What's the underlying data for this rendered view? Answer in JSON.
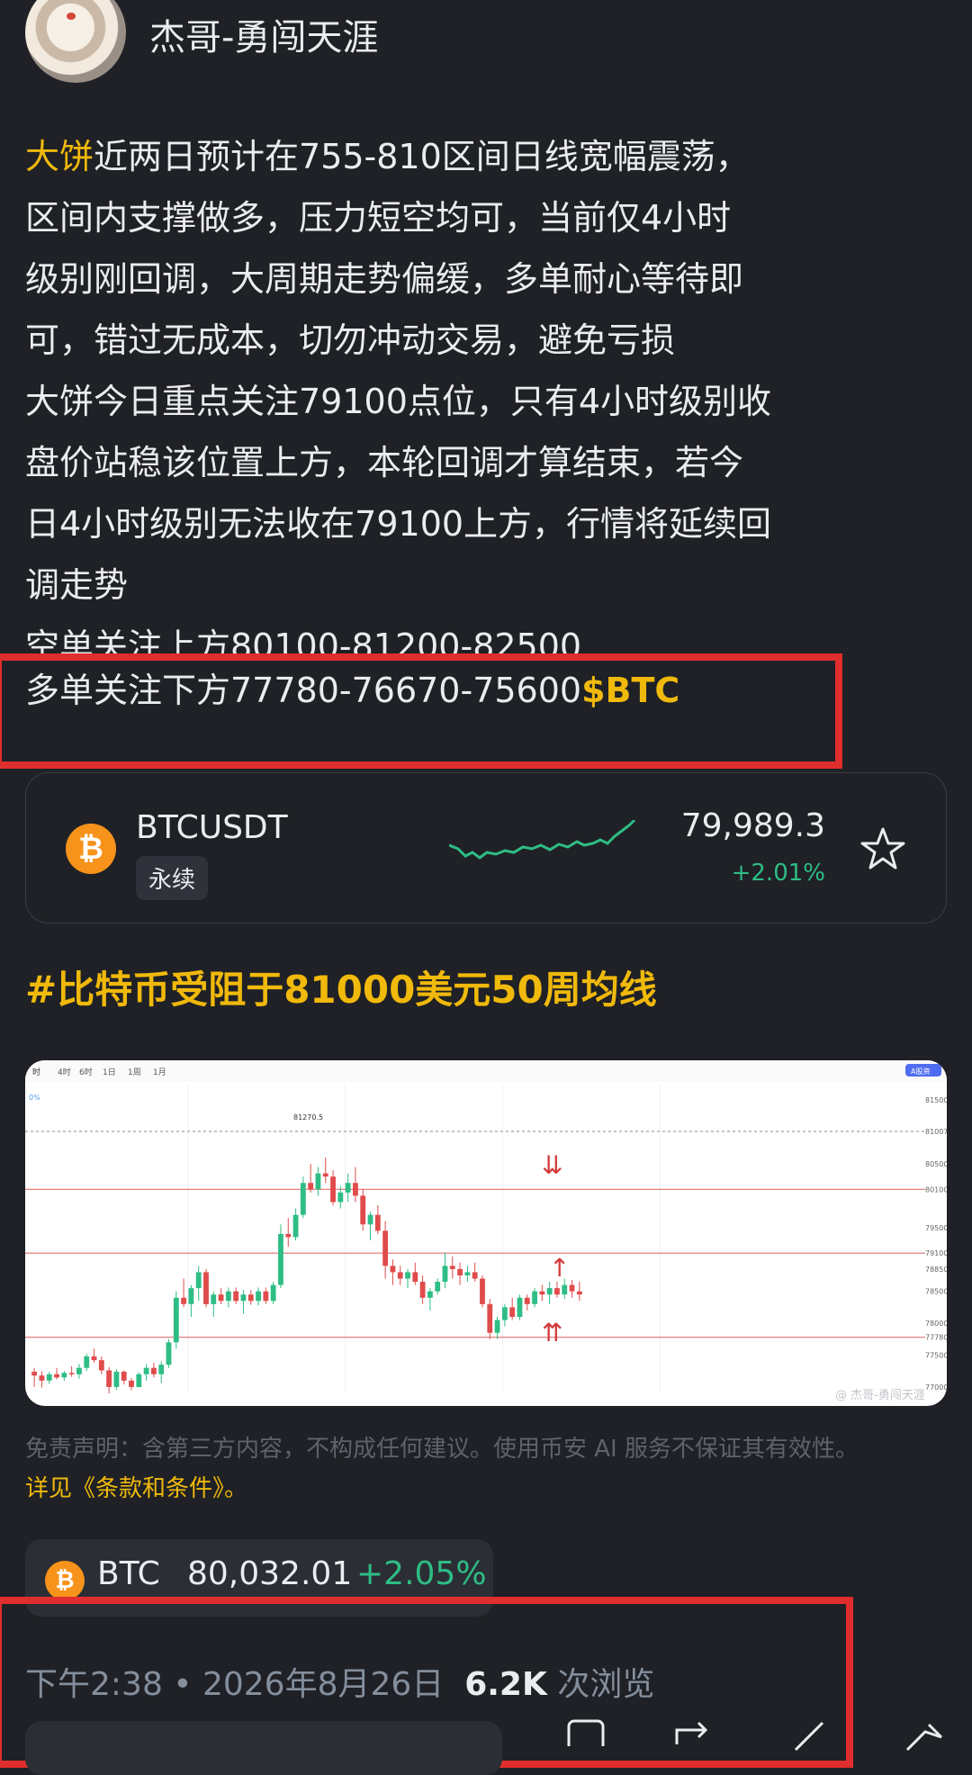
{
  "author": {
    "name": "杰哥-勇闯天涯"
  },
  "post": {
    "p1_highlight": "大饼",
    "p1_lines": [
      "近两日预计在755-810区间日线宽幅震荡，",
      "区间内支撑做多，压力短空均可，当前仅4小时",
      "级别刚回调，大周期走势偏缓，多单耐心等待即",
      "可，错过无成本，切勿冲动交易，避免亏损"
    ],
    "p2_lines": [
      "大饼今日重点关注79100点位，只有4小时级别收",
      "盘价站稳该位置上方，本轮回调才算结束，若今",
      "日4小时级别无法收在79100上方，行情将延续回",
      "调走势"
    ],
    "short_line": "空单关注上方80100-81200-82500",
    "long_line": "多单关注下方77780-76670-75600",
    "long_tag": "$BTC"
  },
  "ticker": {
    "symbol": "BTCUSDT",
    "badge": "永续",
    "price": "79,989.3",
    "change": "+2.01%",
    "coin_glyph": "₿",
    "star_icon": "star-outline",
    "colors": {
      "up": "#2ebd85",
      "coin": "#f7931a"
    }
  },
  "heading": "#比特币受阻于81000美元50周均线",
  "chart": {
    "tabs": [
      "时",
      "4时",
      "6时",
      "1日",
      "1周",
      "1月"
    ],
    "top_right": "A股资",
    "pct_label": "0%",
    "high_label": "81270.5",
    "price_axis": [
      "81500.0",
      "81007.7",
      "80500.0",
      "80100.0",
      "79500.0",
      "79100.0",
      "78850.3",
      "78500.0",
      "78000.0",
      "77780.0",
      "77500.0",
      "77000.0"
    ],
    "watermark": "@ 杰哥-勇闯天涯",
    "levels": [
      80100,
      79100,
      77780
    ],
    "arrows": [
      "⇊",
      "↑",
      "⇈"
    ],
    "chart_data": {
      "type": "candlestick",
      "ylim": [
        76900,
        81700
      ],
      "candles": [
        [
          77240,
          77300,
          77000,
          77180
        ],
        [
          77180,
          77250,
          76990,
          77100
        ],
        [
          77100,
          77240,
          77050,
          77200
        ],
        [
          77200,
          77300,
          77120,
          77150
        ],
        [
          77150,
          77250,
          77100,
          77220
        ],
        [
          77220,
          77330,
          77160,
          77200
        ],
        [
          77200,
          77360,
          77130,
          77300
        ],
        [
          77300,
          77520,
          77250,
          77480
        ],
        [
          77480,
          77600,
          77380,
          77420
        ],
        [
          77420,
          77480,
          77200,
          77260
        ],
        [
          77260,
          77310,
          76900,
          77000
        ],
        [
          77000,
          77280,
          76950,
          77240
        ],
        [
          77240,
          77260,
          77040,
          77100
        ],
        [
          77100,
          77140,
          76950,
          77000
        ],
        [
          77000,
          77230,
          76990,
          77200
        ],
        [
          77200,
          77360,
          77100,
          77300
        ],
        [
          77300,
          77380,
          77150,
          77200
        ],
        [
          77200,
          77400,
          77060,
          77350
        ],
        [
          77350,
          77750,
          77300,
          77700
        ],
        [
          77700,
          78500,
          77600,
          78400
        ],
        [
          78400,
          78700,
          78250,
          78300
        ],
        [
          78300,
          78600,
          78100,
          78550
        ],
        [
          78550,
          78900,
          78350,
          78800
        ],
        [
          78800,
          78850,
          78250,
          78300
        ],
        [
          78300,
          78500,
          78100,
          78450
        ],
        [
          78450,
          78550,
          78300,
          78350
        ],
        [
          78350,
          78560,
          78250,
          78500
        ],
        [
          78500,
          78560,
          78300,
          78350
        ],
        [
          78350,
          78520,
          78150,
          78450
        ],
        [
          78450,
          78520,
          78290,
          78350
        ],
        [
          78350,
          78560,
          78280,
          78500
        ],
        [
          78500,
          78560,
          78300,
          78350
        ],
        [
          78350,
          78650,
          78300,
          78600
        ],
        [
          78600,
          79550,
          78550,
          79400
        ],
        [
          79400,
          79650,
          79200,
          79350
        ],
        [
          79350,
          79800,
          79300,
          79700
        ],
        [
          79700,
          80300,
          79650,
          80200
        ],
        [
          80200,
          80500,
          80050,
          80100
        ],
        [
          80100,
          80450,
          80000,
          80350
        ],
        [
          80350,
          80600,
          80200,
          80300
        ],
        [
          80300,
          80400,
          79850,
          79900
        ],
        [
          79900,
          80150,
          79800,
          80050
        ],
        [
          80050,
          80350,
          79900,
          80200
        ],
        [
          80200,
          80450,
          79900,
          80000
        ],
        [
          80000,
          80100,
          79450,
          79550
        ],
        [
          79550,
          79750,
          79300,
          79700
        ],
        [
          79700,
          79850,
          79400,
          79450
        ],
        [
          79450,
          79600,
          78700,
          78900
        ],
        [
          78900,
          79000,
          78600,
          78800
        ],
        [
          78800,
          78900,
          78600,
          78700
        ],
        [
          78700,
          78850,
          78550,
          78800
        ],
        [
          78800,
          78950,
          78600,
          78650
        ],
        [
          78650,
          78750,
          78300,
          78400
        ],
        [
          78400,
          78550,
          78200,
          78500
        ],
        [
          78500,
          78700,
          78450,
          78650
        ],
        [
          78650,
          79100,
          78550,
          78900
        ],
        [
          78900,
          79050,
          78700,
          78850
        ],
        [
          78850,
          78950,
          78600,
          78750
        ],
        [
          78750,
          78900,
          78650,
          78800
        ],
        [
          78800,
          78950,
          78650,
          78700
        ],
        [
          78700,
          78750,
          78250,
          78300
        ],
        [
          78300,
          78380,
          77750,
          77850
        ],
        [
          77850,
          78100,
          77750,
          78050
        ],
        [
          78050,
          78300,
          77950,
          78250
        ],
        [
          78250,
          78400,
          78050,
          78100
        ],
        [
          78100,
          78450,
          78050,
          78400
        ],
        [
          78400,
          78450,
          78200,
          78300
        ],
        [
          78300,
          78550,
          78250,
          78500
        ],
        [
          78500,
          78600,
          78350,
          78450
        ],
        [
          78450,
          78650,
          78300,
          78550
        ],
        [
          78550,
          78650,
          78400,
          78450
        ],
        [
          78450,
          78700,
          78380,
          78600
        ],
        [
          78600,
          78680,
          78400,
          78500
        ],
        [
          78500,
          78650,
          78350,
          78450
        ]
      ]
    }
  },
  "disclaimer": {
    "text": "免责声明：含第三方内容，不构成任何建议。使用币安 AI 服务不保证其有效性。",
    "link": "详见《条款和条件》。"
  },
  "chip": {
    "symbol": "BTC",
    "price": "80,032.01",
    "change": "+2.05%",
    "coin_glyph": "₿"
  },
  "meta": {
    "time": "下午2:38 • 2026年8月26日",
    "views": "6.2K",
    "views_suffix": "次浏览"
  },
  "bottom_icons": [
    "comment-icon",
    "repost-icon",
    "quote-icon",
    "share-icon"
  ]
}
